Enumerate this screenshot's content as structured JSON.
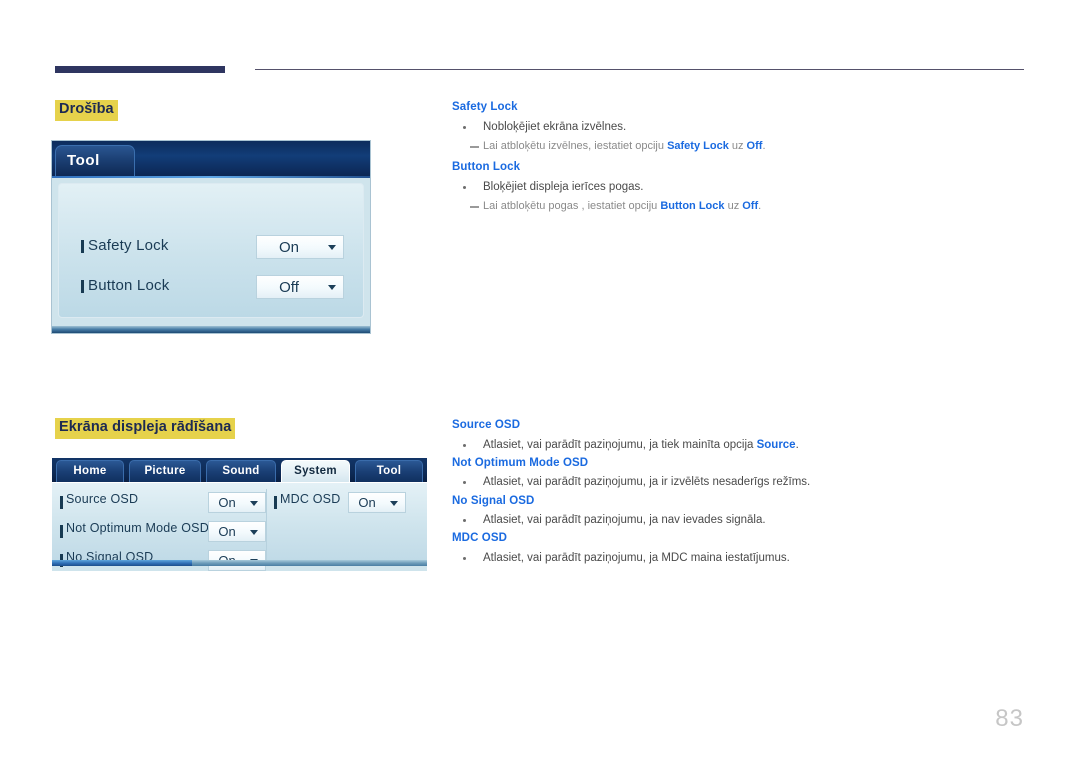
{
  "page": {
    "number": "83"
  },
  "sections": [
    {
      "heading": "Drošība",
      "panel": {
        "tab_label": "Tool",
        "rows": [
          {
            "label": "Safety Lock",
            "value": "On"
          },
          {
            "label": "Button Lock",
            "value": "Off"
          }
        ]
      },
      "descriptions": [
        {
          "title": "Safety Lock",
          "bullet": "Nobloķējiet ekrāna izvēlnes.",
          "note_pre": "Lai atbloķētu izvēlnes, iestatiet opciju ",
          "note_term": "Safety Lock",
          "note_mid": " uz ",
          "note_value": "Off",
          "note_post": "."
        },
        {
          "title": "Button Lock",
          "bullet": "Bloķējiet displeja ierīces pogas.",
          "note_pre": "Lai atbloķētu pogas , iestatiet opciju ",
          "note_term": "Button Lock",
          "note_mid": " uz ",
          "note_value": "Off",
          "note_post": "."
        }
      ]
    },
    {
      "heading": "Ekrāna displeja rādīšana",
      "panel": {
        "tabs": [
          {
            "label": "Home",
            "active": false
          },
          {
            "label": "Picture",
            "active": false
          },
          {
            "label": "Sound",
            "active": false
          },
          {
            "label": "System",
            "active": true
          },
          {
            "label": "Tool",
            "active": false
          }
        ],
        "rows_left": [
          {
            "label": "Source OSD",
            "value": "On"
          },
          {
            "label": "Not Optimum Mode OSD",
            "value": "On"
          },
          {
            "label": "No Signal OSD",
            "value": "On"
          }
        ],
        "rows_right": [
          {
            "label": "MDC OSD",
            "value": "On"
          }
        ]
      },
      "descriptions": [
        {
          "title": "Source OSD",
          "bullet_pre": "Atlasiet, vai parādīt paziņojumu, ja tiek mainīta opcija ",
          "bullet_term": "Source",
          "bullet_post": "."
        },
        {
          "title": "Not Optimum Mode OSD",
          "bullet_pre": "Atlasiet, vai parādīt paziņojumu, ja ir izvēlēts nesaderīgs režīms.",
          "bullet_term": "",
          "bullet_post": ""
        },
        {
          "title": "No Signal OSD",
          "bullet_pre": "Atlasiet, vai parādīt paziņojumu, ja nav ievades signāla.",
          "bullet_term": "",
          "bullet_post": ""
        },
        {
          "title": "MDC OSD",
          "bullet_pre": "Atlasiet, vai parādīt paziņojumu, ja MDC maina iestatījumus.",
          "bullet_term": "",
          "bullet_post": ""
        }
      ]
    }
  ]
}
